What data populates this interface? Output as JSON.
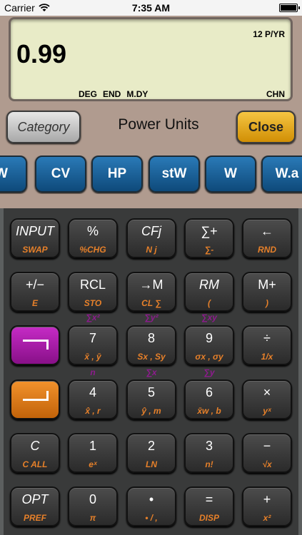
{
  "status": {
    "carrier": "Carrier",
    "time": "7:35 AM"
  },
  "display": {
    "payments_per_year": "12 P/YR",
    "value": "0.99",
    "angle_mode": "DEG",
    "payment_mode": "END",
    "date_format": "M.DY",
    "language": "CHN"
  },
  "header": {
    "category_label": "Category",
    "title": "Power Units",
    "close_label": "Close"
  },
  "units": [
    "W",
    "CV",
    "HP",
    "stW",
    "W",
    "W.a"
  ],
  "keys": [
    [
      {
        "main": "INPUT",
        "sub": "SWAP"
      },
      {
        "main": "%",
        "sub": "%CHG"
      },
      {
        "main": "CFj",
        "sub": "N j"
      },
      {
        "main": "∑+",
        "sub": "∑-"
      },
      {
        "main": "←",
        "sub": "RND"
      }
    ],
    [
      {
        "main": "+/−",
        "sub": "E"
      },
      {
        "main": "RCL",
        "sub": "STO"
      },
      {
        "main": "→M",
        "sub": "CL ∑"
      },
      {
        "main": "RM",
        "sub": "("
      },
      {
        "main": "M+",
        "sub": ")"
      }
    ],
    [
      {
        "main": "",
        "sub": ""
      },
      {
        "main": "7",
        "sub": "x̄ , ȳ"
      },
      {
        "main": "8",
        "sub": "Sx , Sy"
      },
      {
        "main": "9",
        "sub": "σx , σy"
      },
      {
        "main": "÷",
        "sub": "1/x"
      }
    ],
    [
      {
        "main": "",
        "sub": ""
      },
      {
        "main": "4",
        "sub": "x̂ , r"
      },
      {
        "main": "5",
        "sub": "ŷ , m"
      },
      {
        "main": "6",
        "sub": "x̄w , b"
      },
      {
        "main": "×",
        "sub": "yˣ"
      }
    ],
    [
      {
        "main": "C",
        "sub": "C ALL"
      },
      {
        "main": "1",
        "sub": "eˣ"
      },
      {
        "main": "2",
        "sub": "LN"
      },
      {
        "main": "3",
        "sub": "n!"
      },
      {
        "main": "−",
        "sub": "√x"
      }
    ],
    [
      {
        "main": "OPT",
        "sub": "PREF"
      },
      {
        "main": "0",
        "sub": "π"
      },
      {
        "main": "•",
        "sub": "• / ,"
      },
      {
        "main": "=",
        "sub": "DISP"
      },
      {
        "main": "+",
        "sub": "x²"
      }
    ]
  ],
  "above_labels": {
    "row3": [
      "∑x²",
      "∑y²",
      "∑xy"
    ],
    "row4": [
      "n",
      "∑x",
      "∑y"
    ]
  }
}
